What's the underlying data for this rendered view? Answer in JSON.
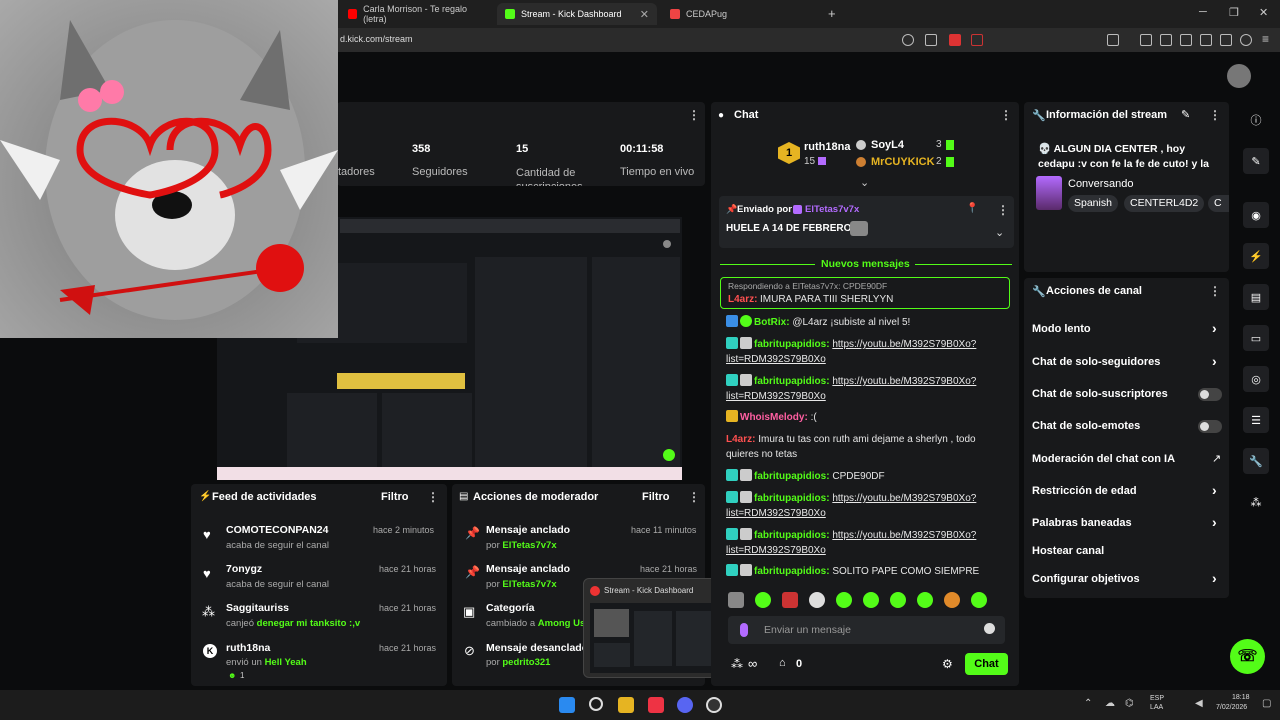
{
  "browser": {
    "tabs": [
      {
        "label": "Carla Morrison - Te regalo (letra)"
      },
      {
        "label": "Stream - Kick Dashboard"
      },
      {
        "label": "CEDAPug"
      }
    ],
    "new_tab": "+",
    "url": "d.kick.com/stream",
    "window_controls": [
      "─",
      "❐",
      "✕"
    ]
  },
  "stats": {
    "menu": "⋮",
    "items": [
      {
        "value": "",
        "label": "tadores"
      },
      {
        "value": "358",
        "label": "Seguidores"
      },
      {
        "value": "15",
        "label": "Cantidad de suscripciones"
      },
      {
        "value": "00:11:58",
        "label": "Tiempo en vivo"
      }
    ]
  },
  "chat": {
    "title": "Chat",
    "leaderboard": [
      {
        "rank": "1",
        "name": "ruth18na",
        "count": "15"
      },
      {
        "name": "SoyL4",
        "count": "3"
      },
      {
        "name": "MrCUYKICK",
        "count": "2"
      }
    ],
    "pinned": {
      "sent_by_label": "Enviado por",
      "author": "ElTetas7v7x",
      "message": "HUELE A 14 DE FEBRERO"
    },
    "new_messages_label": "Nuevos mensajes",
    "reply": {
      "reply_label": "Respondiendo a ElTetas7v7x: CPDE90DF",
      "author": "L4arz:",
      "text": "IMURA PARA TIII SHERLYYN"
    },
    "messages": [
      {
        "author": "BotRix:",
        "text": "@L4arz ¡subiste al nivel 5!"
      },
      {
        "author": "fabritupapidios:",
        "text": "https://youtu.be/M392S79B0Xo?list=RDM392S79B0Xo"
      },
      {
        "author": "fabritupapidios:",
        "text": "https://youtu.be/M392S79B0Xo?list=RDM392S79B0Xo"
      },
      {
        "author": "WhoisMelody:",
        "text": ":("
      },
      {
        "author": "L4arz:",
        "text": "Imura tu tas con ruth ami dejame a sherlyn , todo quieres no tetas"
      },
      {
        "author": "fabritupapidios:",
        "text": "CPDE90DF"
      },
      {
        "author": "fabritupapidios:",
        "text": "https://youtu.be/M392S79B0Xo?list=RDM392S79B0Xo"
      },
      {
        "author": "fabritupapidios:",
        "text": "https://youtu.be/M392S79B0Xo?list=RDM392S79B0Xo"
      },
      {
        "author": "fabritupapidios:",
        "text": "SOLITO PAPE COMO SIEMPRE"
      }
    ],
    "input_placeholder": "Enviar un mensaje",
    "points": "0",
    "send_label": "Chat"
  },
  "stream_info": {
    "title": "Información del stream",
    "stream_title": "💀 ALGUN DIA CENTER , hoy cedapu :v con fe la fe de cuto! y la fe de...",
    "category": "Conversando",
    "tags": [
      "Spanish",
      "CENTERL4D2",
      "C"
    ]
  },
  "channel_actions": {
    "title": "Acciones de canal",
    "items": [
      {
        "label": "Modo lento",
        "control": "chevron"
      },
      {
        "label": "Chat de solo-seguidores",
        "control": "chevron"
      },
      {
        "label": "Chat de solo-suscriptores",
        "control": "toggle"
      },
      {
        "label": "Chat de solo-emotes",
        "control": "toggle"
      },
      {
        "label": "Moderación del chat con IA",
        "control": "external"
      },
      {
        "label": "Restricción de edad",
        "control": "chevron"
      },
      {
        "label": "Palabras baneadas",
        "control": "chevron"
      },
      {
        "label": "Hostear canal",
        "control": "none"
      },
      {
        "label": "Configurar objetivos",
        "control": "chevron"
      }
    ]
  },
  "activity_feed": {
    "title": "Feed de actividades",
    "filter_label": "Filtro",
    "items": [
      {
        "name": "COMOTECONPAN24",
        "sub": "acaba de seguir el canal",
        "time": "hace 2 minutos"
      },
      {
        "name": "7onygz",
        "sub": "acaba de seguir el canal",
        "time": "hace 21 horas"
      },
      {
        "name": "Saggitauriss",
        "sub_prefix": "canjeó",
        "sub_highlight": "denegar mi tanksito :,v",
        "time": "hace 21 horas"
      },
      {
        "name": "ruth18na",
        "sub_prefix": "envió un",
        "sub_highlight": "Hell Yeah",
        "time": "hace 21 horas",
        "extra": "1"
      }
    ]
  },
  "mod_actions": {
    "title": "Acciones de moderador",
    "filter_label": "Filtro",
    "items": [
      {
        "name": "Mensaje anclado",
        "sub_prefix": "por",
        "sub_highlight": "ElTetas7v7x",
        "time": "hace 11 minutos"
      },
      {
        "name": "Mensaje anclado",
        "sub_prefix": "por",
        "sub_highlight": "ElTetas7v7x",
        "time": "hace 21 horas"
      },
      {
        "name": "Categoría",
        "sub_prefix": "cambiado a",
        "sub_highlight": "Among Us",
        "time": ""
      },
      {
        "name": "Mensaje desanclado",
        "sub_prefix": "por",
        "sub_highlight": "pedrito321",
        "time": ""
      }
    ]
  },
  "thumbnail_popup": {
    "title": "Stream - Kick Dashboard"
  },
  "taskbar": {
    "lang": "ESP",
    "region": "LAA",
    "time": "18:18",
    "date": "7/02/2026"
  },
  "colors": {
    "accent": "#53fc18",
    "panel": "#18191b",
    "background": "#0b0c0d"
  }
}
